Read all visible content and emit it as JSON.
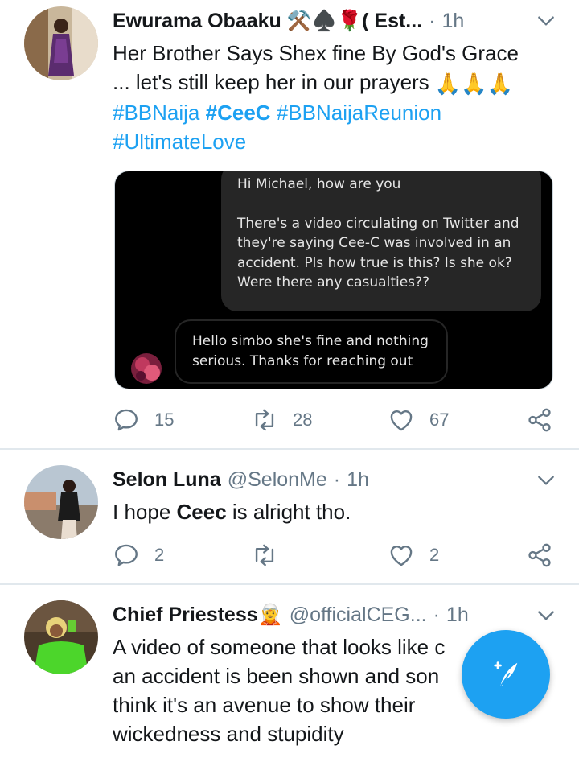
{
  "tweets": [
    {
      "name": "Ewurama Obaaku ⚒️♠️🌹( Est...",
      "handle": "",
      "time": "1h",
      "text_line1": "Her Brother Says Shex fine By God's Grace",
      "text_line2": "... let's still keep her in our prayers ",
      "prayer_emojis": "🙏🙏🙏",
      "hashtags": [
        "#BBNaija",
        "#CeeC",
        "#BBNaijaReunion",
        "#UltimateLove"
      ],
      "media": {
        "my_message_1": "Hi Michael, how are you",
        "my_message_2": "There's a video circulating on Twitter and they're saying Cee-C was involved in an accident. Pls how true is this? Is she ok? Were there any casualties??",
        "their_message": "Hello simbo she's fine and nothing serious. Thanks for reaching out"
      },
      "replies": "15",
      "retweets": "28",
      "likes": "67"
    },
    {
      "name": "Selon Luna",
      "handle": "@SelonMe",
      "time": "1h",
      "text_prefix": "I hope ",
      "text_bold": "Ceec",
      "text_suffix": " is alright tho.",
      "replies": "2",
      "retweets": "",
      "likes": "2"
    },
    {
      "name": "Chief Priestess🧝",
      "handle": "@officialCEG...",
      "time": "1h",
      "lines": [
        "A video of someone that looks like c",
        "an accident is been shown and son",
        "think it's an avenue to show their",
        "wickedness and stupidity"
      ]
    }
  ],
  "icons": {
    "caret": "chevron-down-icon",
    "reply": "reply-icon",
    "retweet": "retweet-icon",
    "like": "heart-icon",
    "share": "share-icon",
    "compose": "compose-tweet-icon"
  },
  "colors": {
    "accent": "#1da1f2",
    "muted": "#657786",
    "text": "#14171a"
  }
}
